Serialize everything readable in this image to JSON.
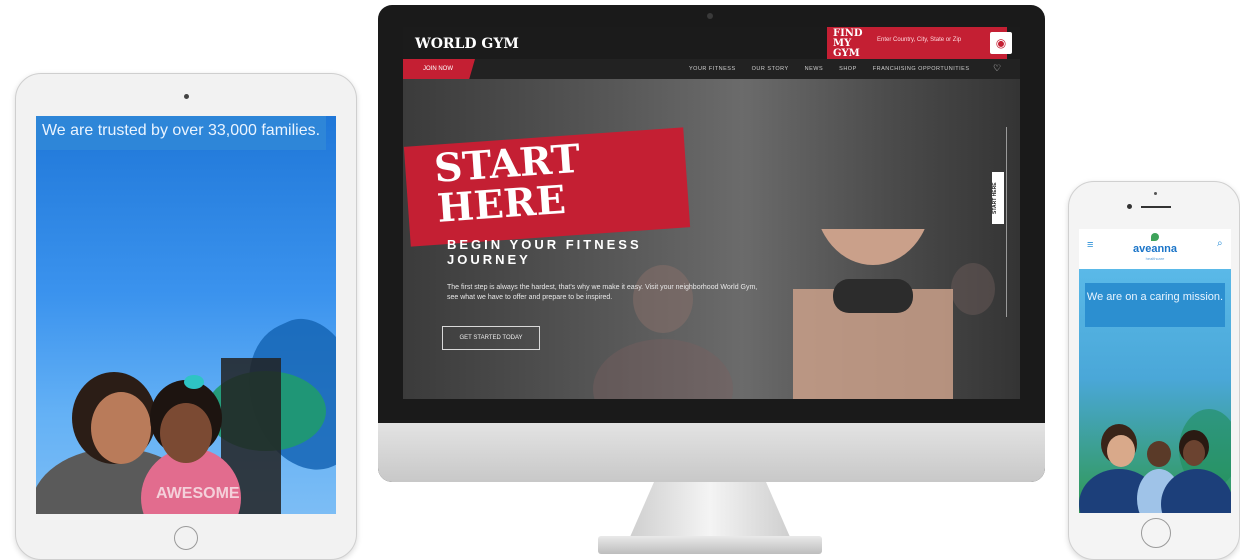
{
  "tablet": {
    "headline": "We are trusted by over 33,000 families."
  },
  "monitor": {
    "logo": "WORLD GYM",
    "find_label": "FIND MY GYM",
    "find_placeholder": "Enter Country, City, State or Zip",
    "join_label": "JOIN NOW",
    "nav": [
      "YOUR FITNESS",
      "OUR STORY",
      "NEWS",
      "SHOP",
      "FRANCHISING OPPORTUNITIES"
    ],
    "hero_title_1": "START",
    "hero_title_2": "HERE",
    "hero_sub": "BEGIN YOUR FITNESS JOURNEY",
    "hero_copy": "The first step is always the hardest, that's why we make it easy. Visit your neighborhood World Gym, see what we have to offer and prepare to be inspired.",
    "cta": "GET STARTED TODAY",
    "side_label": "START HERE"
  },
  "phone": {
    "logo": "aveanna",
    "logo_sub": "healthcare",
    "headline": "We are on a caring mission."
  },
  "colors": {
    "brand_red": "#c41f33",
    "tablet_blue": "#2e86d8",
    "aveanna_blue": "#1a74c8"
  }
}
